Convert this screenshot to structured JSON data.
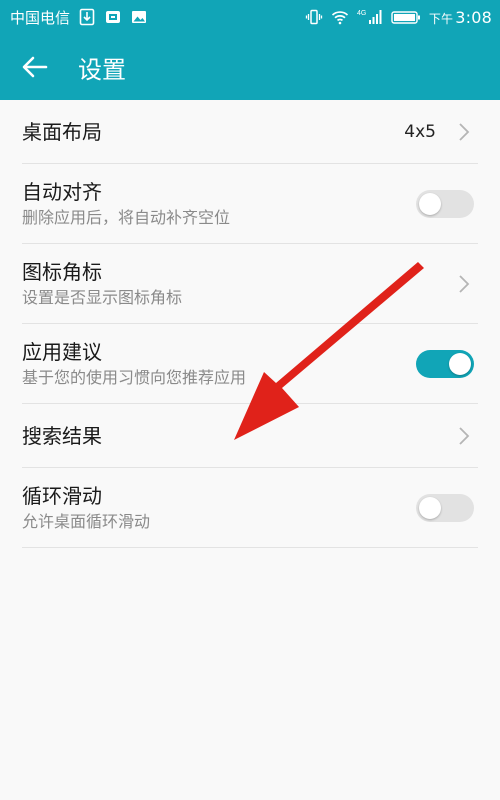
{
  "status_bar": {
    "carrier": "中国电信",
    "network_label": "4G",
    "time_prefix": "下午",
    "time": "3:08"
  },
  "header": {
    "title": "设置"
  },
  "colors": {
    "accent": "#11a5b7",
    "arrow": "#e0221a"
  },
  "settings": [
    {
      "title": "桌面布局",
      "value": "4x5",
      "control": "chevron"
    },
    {
      "title": "自动对齐",
      "subtitle": "删除应用后，将自动补齐空位",
      "control": "toggle",
      "enabled": false
    },
    {
      "title": "图标角标",
      "subtitle": "设置是否显示图标角标",
      "control": "chevron"
    },
    {
      "title": "应用建议",
      "subtitle": "基于您的使用习惯向您推荐应用",
      "control": "toggle",
      "enabled": true
    },
    {
      "title": "搜索结果",
      "control": "chevron"
    },
    {
      "title": "循环滑动",
      "subtitle": "允许桌面循环滑动",
      "control": "toggle",
      "enabled": false
    }
  ]
}
